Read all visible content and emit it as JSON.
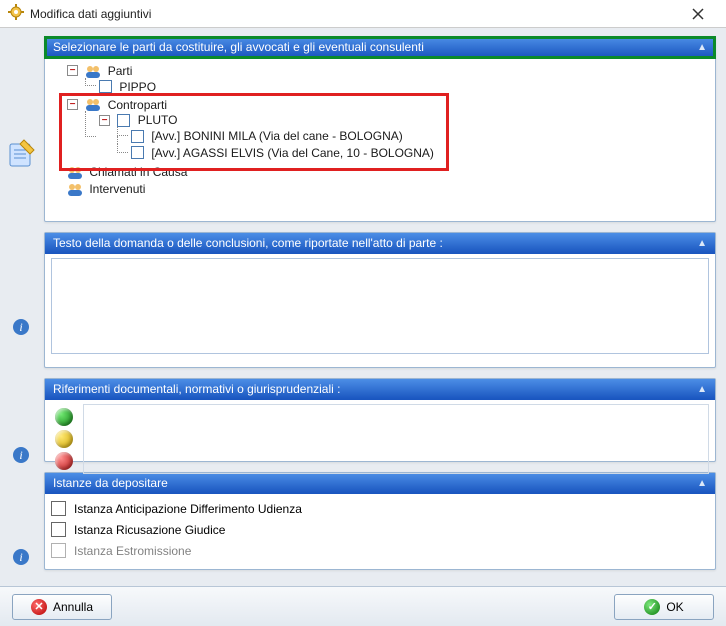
{
  "window": {
    "title": "Modifica dati aggiuntivi"
  },
  "panel_parties": {
    "header": "Selezionare le parti da costituire, gli avvocati e gli eventuali consulenti",
    "tree": {
      "parti_label": "Parti",
      "parti_child": "PIPPO",
      "contro_label": "Controparti",
      "pluto_label": "PLUTO",
      "avv1": "[Avv.] BONINI MILA (Via del cane - BOLOGNA)",
      "avv2": "[Avv.] AGASSI ELVIS (Via del Cane, 10 - BOLOGNA)",
      "chiamati_label": "Chiamati in Causa",
      "intervenuti_label": "Intervenuti"
    }
  },
  "panel_testo": {
    "header": "Testo della domanda o delle conclusioni, come riportate nell'atto di parte :",
    "value": ""
  },
  "panel_riferimenti": {
    "header": "Riferimenti documentali, normativi o giurisprudenziali :"
  },
  "panel_istanze": {
    "header": "Istanze da depositare",
    "items": [
      "Istanza Anticipazione Differimento Udienza",
      "Istanza Ricusazione Giudice",
      "Istanza Estromissione"
    ]
  },
  "buttons": {
    "cancel": "Annulla",
    "ok": "OK"
  }
}
